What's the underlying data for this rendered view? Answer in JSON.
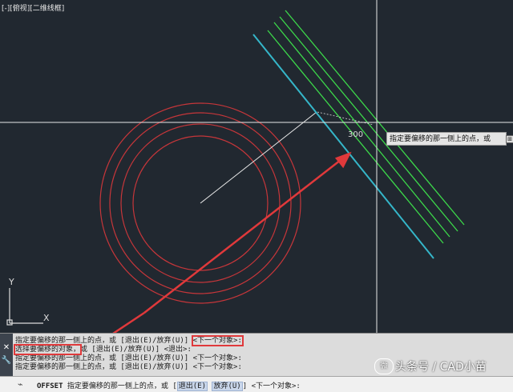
{
  "viewport": {
    "label": "[-][俯视][二维线框]",
    "distance_value": "300",
    "tooltip": "指定要偏移的那一侧上的点，或",
    "tooltip_icon": "⊞",
    "ucs_x": "X",
    "ucs_y": "Y",
    "colors": {
      "background": "#212830",
      "circles": "#c6363a",
      "offset_lines": "#3cd94a",
      "selected_line": "#35b6c9",
      "crosshair": "#ffffff",
      "arrow": "#e0393b"
    }
  },
  "command_history": {
    "lines": [
      {
        "parts": [
          "指定要偏移的那一侧上的点，或 [退出(E)/放弃(U)] ",
          "<下一个对象>:"
        ]
      },
      {
        "parts": [
          "选择要偏移的对象，",
          "或 [退出(E)/放弃(U)] <退出>:"
        ]
      },
      {
        "parts": [
          "指定要偏移的那一侧上的点，或 [退出(E)/放弃(U)] <下一个对象>:"
        ]
      },
      {
        "parts": [
          "指定要偏移的那一侧上的点，或 [退出(E)/放弃(U)] <下一个对象>:"
        ]
      }
    ],
    "close_icon": "✕",
    "wrench_icon": "🔧"
  },
  "command_line": {
    "icon": "⌁",
    "command": "OFFSET",
    "prompt": " 指定要偏移的那一侧上的点，或 [",
    "option1": "退出(E)",
    "sep": " ",
    "option2": "放弃(U)",
    "tail": "] <下一个对象>:"
  },
  "watermark": {
    "logo": "微",
    "text": "头条号 / CAD小苗"
  }
}
